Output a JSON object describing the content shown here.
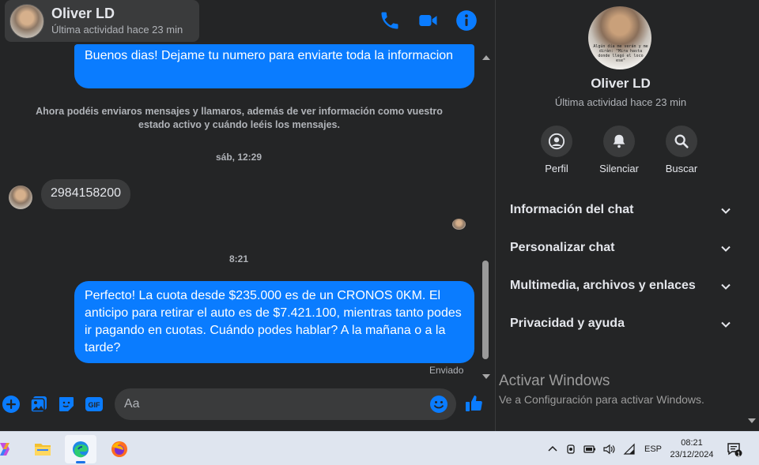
{
  "header": {
    "contact_name": "Oliver LD",
    "contact_status": "Última actividad hace 23 min",
    "icons": [
      "phone-icon",
      "video-icon",
      "info-icon"
    ]
  },
  "messages": {
    "outgoing_1": "Buenos dias! Dejame tu numero para enviarte toda la informacion",
    "system_note": "Ahora podéis enviaros mensajes y llamaros, además de ver información como vuestro estado activo y cuándo leéis los mensajes.",
    "time_1": "sáb, 12:29",
    "incoming_1": "2984158200",
    "time_2": "8:21",
    "outgoing_2": "Perfecto! La cuota desde $235.000 es de un CRONOS 0KM. El anticipo para retirar el auto es de $7.421.100, mientras tanto podes ir pagando en cuotas. Cuándo podes hablar? A la mañana o a la tarde?",
    "sent_status": "Enviado"
  },
  "composer": {
    "placeholder": "Aa",
    "icons": [
      "plus-icon",
      "gallery-icon",
      "sticker-icon",
      "gif-icon",
      "emoji-icon",
      "like-icon"
    ],
    "gif_label": "GIF"
  },
  "info_panel": {
    "name": "Oliver LD",
    "status": "Última actividad hace 23 min",
    "avatar_caption": "Algún día me verán y me dirán: \"Mira hasta donde llegó el loco ese\"",
    "actions": [
      {
        "label": "Perfil",
        "icon": "profile-icon"
      },
      {
        "label": "Silenciar",
        "icon": "bell-icon"
      },
      {
        "label": "Buscar",
        "icon": "search-icon"
      }
    ],
    "sections": [
      {
        "label": "Información del chat"
      },
      {
        "label": "Personalizar chat"
      },
      {
        "label": "Multimedia, archivos y enlaces"
      },
      {
        "label": "Privacidad y ayuda"
      }
    ],
    "activation_title": "Activar Windows",
    "activation_subtitle": "Ve a Configuración para activar Windows."
  },
  "taskbar": {
    "apps": [
      "copilot-icon",
      "file-explorer-icon",
      "edge-icon",
      "firefox-icon"
    ],
    "active_app": "edge-icon",
    "language": "ESP",
    "time": "08:21",
    "date": "23/12/2024",
    "notification_count": "1"
  },
  "colors": {
    "accent": "#0a7cff",
    "background": "#242526",
    "bubble_incoming": "#3a3b3c",
    "text_primary": "#e4e6eb",
    "text_secondary": "#b0b3b8"
  }
}
